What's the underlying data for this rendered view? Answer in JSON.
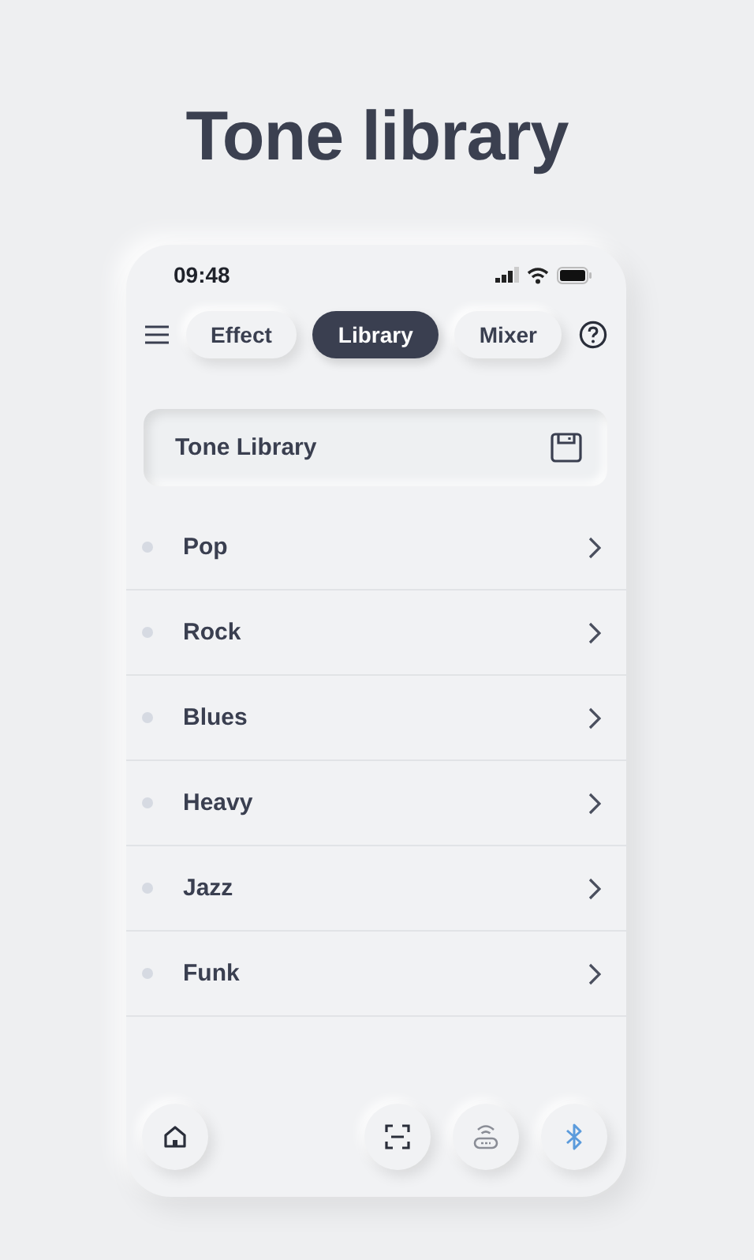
{
  "heading": "Tone library",
  "status_bar": {
    "time": "09:48"
  },
  "tabs": [
    {
      "label": "Effect",
      "selected": false
    },
    {
      "label": "Library",
      "selected": true
    },
    {
      "label": "Mixer",
      "selected": false
    }
  ],
  "library_box": {
    "title": "Tone Library"
  },
  "genres": [
    {
      "label": "Pop"
    },
    {
      "label": "Rock"
    },
    {
      "label": "Blues"
    },
    {
      "label": "Heavy"
    },
    {
      "label": "Jazz"
    },
    {
      "label": "Funk"
    }
  ]
}
